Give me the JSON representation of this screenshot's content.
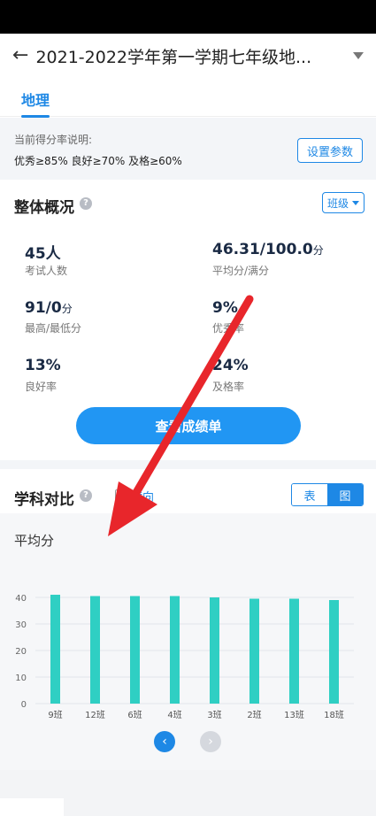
{
  "header": {
    "title": "2021-2022学年第一学期七年级地..."
  },
  "tabs": [
    {
      "label": "地理",
      "active": true
    }
  ],
  "note": {
    "title": "当前得分率说明:",
    "text": "优秀≥85% 良好≥70% 及格≥60%",
    "button_label": "设置参数"
  },
  "overview": {
    "title": "整体概况",
    "filter_label": "班级",
    "stats": [
      {
        "value": "45人",
        "unit": "",
        "label": "考试人数"
      },
      {
        "value": "46.31/100.0",
        "unit": "分",
        "label": "平均分/满分"
      },
      {
        "value": "91/0",
        "unit": "分",
        "label": "最高/最低分"
      },
      {
        "value": "9%",
        "unit": "",
        "label": "优秀率"
      },
      {
        "value": "13%",
        "unit": "",
        "label": "良好率"
      },
      {
        "value": "24%",
        "unit": "",
        "label": "及格率"
      }
    ],
    "button_label": "查看成绩单"
  },
  "compare": {
    "title": "学科对比",
    "checkbox_label": "横向",
    "toggle": {
      "table_label": "表",
      "chart_label": "图",
      "selected": "图"
    },
    "metric_label": "平均分"
  },
  "chart_data": {
    "type": "bar",
    "categories": [
      "9班",
      "12班",
      "6班",
      "4班",
      "3班",
      "2班",
      "13班",
      "18班"
    ],
    "values": [
      41,
      40.5,
      40.5,
      40.5,
      40,
      39.5,
      39.5,
      39
    ],
    "title": "平均分",
    "xlabel": "",
    "ylabel": "",
    "ylim": [
      0,
      45
    ],
    "yticks": [
      0,
      10,
      20,
      30,
      40
    ],
    "grid": true,
    "bar_color": "#2fcfc3"
  },
  "colors": {
    "accent": "#1e88e5",
    "annotation_arrow": "#e8262b"
  }
}
